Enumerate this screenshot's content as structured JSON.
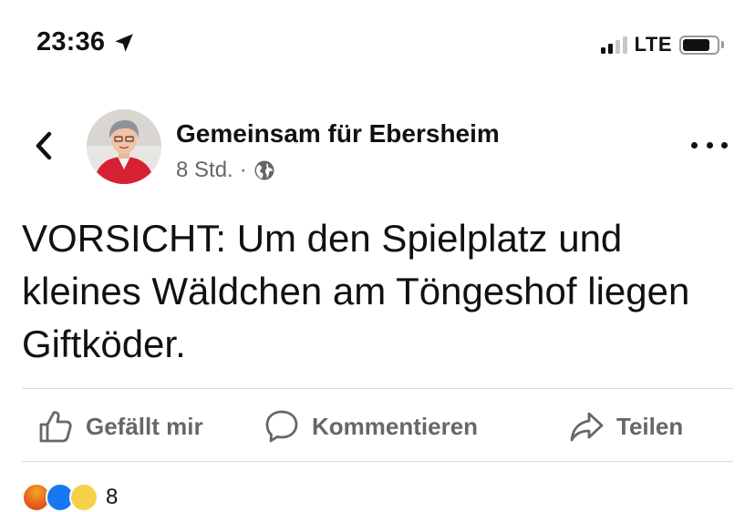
{
  "status_bar": {
    "time": "23:36",
    "network": "LTE",
    "location_icon": "location-arrow-icon",
    "signal_bars_active": 2,
    "signal_bars_total": 4,
    "battery_level": 0.8
  },
  "post": {
    "page_name": "Gemeinsam für Ebersheim",
    "time_ago": "8 Std.",
    "separator": "·",
    "audience_icon": "globe-icon",
    "text": "VORSICHT: Um den Spielplatz und kleines Wäldchen am Töngeshof liegen Giftköder."
  },
  "actions": {
    "like_label": "Gefällt mir",
    "comment_label": "Kommentieren",
    "share_label": "Teilen"
  },
  "reactions": {
    "icons": [
      "angry-reaction-icon",
      "like-reaction-icon",
      "haha-reaction-icon"
    ],
    "count": "8"
  },
  "colors": {
    "text": "#111111",
    "secondary_text": "#65676b",
    "divider": "#d7d9dc",
    "like_blue": "#1877f2",
    "avatar_jacket": "#d62132"
  }
}
